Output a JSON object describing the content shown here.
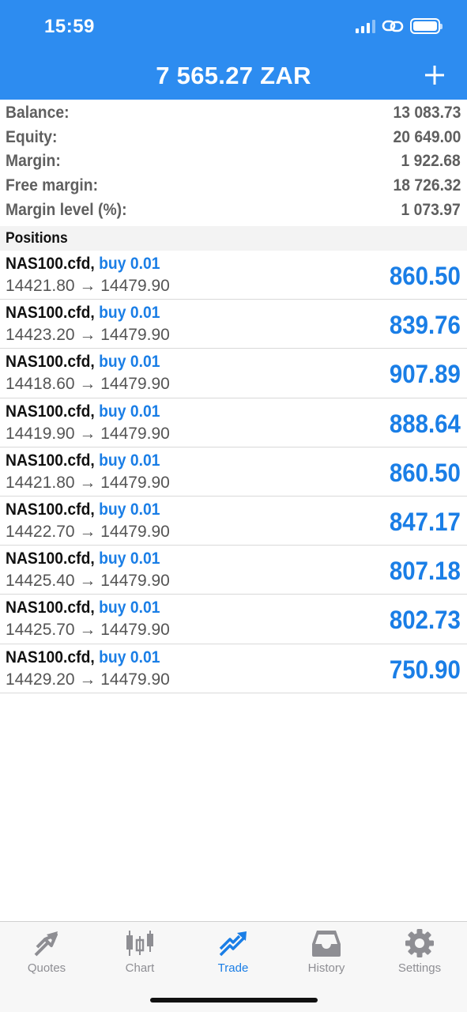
{
  "status_bar": {
    "time": "15:59"
  },
  "header": {
    "title": "7 565.27 ZAR",
    "add_icon": "plus-icon"
  },
  "summary": [
    {
      "label": "Balance:",
      "value": "13 083.73"
    },
    {
      "label": "Equity:",
      "value": "20 649.00"
    },
    {
      "label": "Margin:",
      "value": "1 922.68"
    },
    {
      "label": "Free margin:",
      "value": "18 726.32"
    },
    {
      "label": "Margin level (%):",
      "value": "1 073.97"
    }
  ],
  "positions_title": "Positions",
  "positions": [
    {
      "symbol": "NAS100.cfd,",
      "side": "buy 0.01",
      "prices": "14421.80 → 14479.90",
      "profit": "860.50"
    },
    {
      "symbol": "NAS100.cfd,",
      "side": "buy 0.01",
      "prices": "14423.20 → 14479.90",
      "profit": "839.76"
    },
    {
      "symbol": "NAS100.cfd,",
      "side": "buy 0.01",
      "prices": "14418.60 → 14479.90",
      "profit": "907.89"
    },
    {
      "symbol": "NAS100.cfd,",
      "side": "buy 0.01",
      "prices": "14419.90 → 14479.90",
      "profit": "888.64"
    },
    {
      "symbol": "NAS100.cfd,",
      "side": "buy 0.01",
      "prices": "14421.80 → 14479.90",
      "profit": "860.50"
    },
    {
      "symbol": "NAS100.cfd,",
      "side": "buy 0.01",
      "prices": "14422.70 → 14479.90",
      "profit": "847.17"
    },
    {
      "symbol": "NAS100.cfd,",
      "side": "buy 0.01",
      "prices": "14425.40 → 14479.90",
      "profit": "807.18"
    },
    {
      "symbol": "NAS100.cfd,",
      "side": "buy 0.01",
      "prices": "14425.70 → 14479.90",
      "profit": "802.73"
    },
    {
      "symbol": "NAS100.cfd,",
      "side": "buy 0.01",
      "prices": "14429.20 → 14479.90",
      "profit": "750.90"
    }
  ],
  "tabs": [
    {
      "label": "Quotes",
      "icon": "quotes-icon",
      "active": false
    },
    {
      "label": "Chart",
      "icon": "chart-icon",
      "active": false
    },
    {
      "label": "Trade",
      "icon": "trade-icon",
      "active": true
    },
    {
      "label": "History",
      "icon": "history-icon",
      "active": false
    },
    {
      "label": "Settings",
      "icon": "gear-icon",
      "active": false
    }
  ],
  "colors": {
    "header_bg": "#2d8cf0",
    "accent": "#1a7ee6",
    "tab_inactive": "#8e8e93"
  }
}
